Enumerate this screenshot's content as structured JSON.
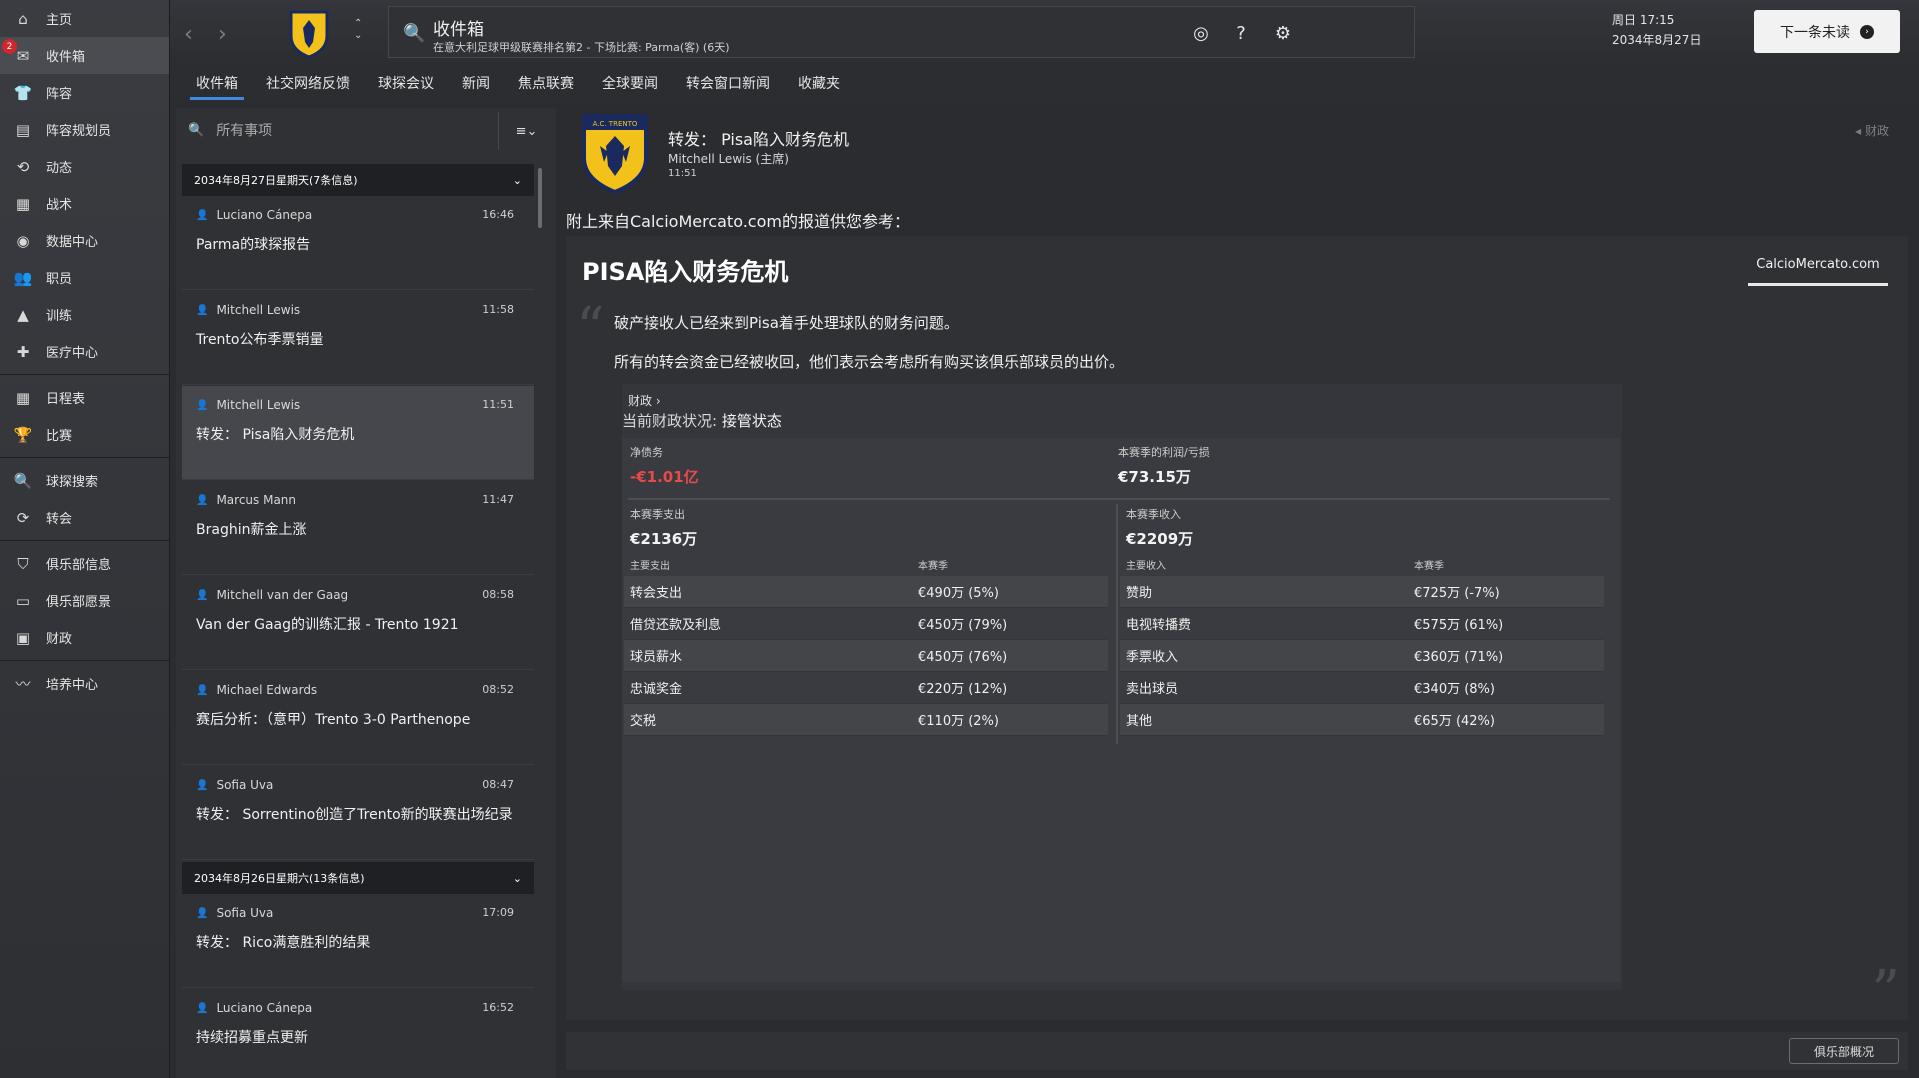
{
  "sidebar": {
    "items": [
      {
        "label": "主页",
        "icon": "home-icon"
      },
      {
        "label": "收件箱",
        "icon": "inbox-icon",
        "badge": "2"
      },
      {
        "label": "阵容",
        "icon": "shirt-icon"
      },
      {
        "label": "阵容规划员",
        "icon": "clipboard-icon"
      },
      {
        "label": "动态",
        "icon": "dynamics-icon"
      },
      {
        "label": "战术",
        "icon": "tactics-icon"
      },
      {
        "label": "数据中心",
        "icon": "data-hub-icon"
      },
      {
        "label": "职员",
        "icon": "staff-icon"
      },
      {
        "label": "训练",
        "icon": "training-icon"
      },
      {
        "label": "医疗中心",
        "icon": "medical-icon"
      },
      {
        "label": "日程表",
        "icon": "calendar-icon"
      },
      {
        "label": "比赛",
        "icon": "trophy-icon"
      },
      {
        "label": "球探搜索",
        "icon": "search-icon"
      },
      {
        "label": "转会",
        "icon": "transfer-icon"
      },
      {
        "label": "俱乐部信息",
        "icon": "shield-icon"
      },
      {
        "label": "俱乐部愿景",
        "icon": "vision-icon"
      },
      {
        "label": "财政",
        "icon": "finance-icon"
      },
      {
        "label": "培养中心",
        "icon": "development-icon"
      }
    ]
  },
  "topbar": {
    "search_title": "收件箱",
    "search_sub": "在意大利足球甲级联赛排名第2 - 下场比赛: Parma(客) (6天)",
    "day_time": "周日 17:15",
    "date": "2034年8月27日",
    "next_button": "下一条未读"
  },
  "tabs": [
    "收件箱",
    "社交网络反馈",
    "球探会议",
    "新闻",
    "焦点联赛",
    "全球要闻",
    "转会窗口新闻",
    "收藏夹"
  ],
  "list": {
    "search_placeholder": "所有事项",
    "group1": "2034年8月27日星期天(7条信息)",
    "group2": "2034年8月26日星期六(13条信息)",
    "messages": [
      {
        "from": "Luciano Cánepa",
        "time": "16:46",
        "subject": "Parma的球探报告"
      },
      {
        "from": "Mitchell Lewis",
        "time": "11:58",
        "subject": "Trento公布季票销量"
      },
      {
        "from": "Mitchell Lewis",
        "time": "11:51",
        "subject": "转发：  Pisa陷入财务危机"
      },
      {
        "from": "Marcus Mann",
        "time": "11:47",
        "subject": "Braghin薪金上涨"
      },
      {
        "from": "Mitchell van der Gaag",
        "time": "08:58",
        "subject": "Van der Gaag的训练汇报 - Trento 1921"
      },
      {
        "from": "Michael Edwards",
        "time": "08:52",
        "subject": "赛后分析：（意甲）Trento 3-0 Parthenope"
      },
      {
        "from": "Sofia Uva",
        "time": "08:47",
        "subject": "转发：  Sorrentino创造了Trento新的联赛出场纪录"
      },
      {
        "from": "Sofia Uva",
        "time": "17:09",
        "subject": "转发：  Rico满意胜利的结果"
      },
      {
        "from": "Luciano Cánepa",
        "time": "16:52",
        "subject": "持续招募重点更新"
      }
    ]
  },
  "article": {
    "crest_text": "A.C. TRENTO",
    "title": "转发：  Pisa陷入财务危机",
    "author": "Mitchell Lewis (主席)",
    "time": "11:51",
    "tag": "财政",
    "intro": "附上来自CalcioMercato.com的报道供您参考：",
    "headline": "PISA陷入财务危机",
    "source": "CalcioMercato.com",
    "para1": "破产接收人已经来到Pisa着手处理球队的财务问题。",
    "para2": "所有的转会资金已经被收回，他们表示会考虑所有购买该俱乐部球员的出价。",
    "finance": {
      "link": "财政",
      "status_label": "当前财政状况: ",
      "status_value": "接管状态",
      "net_debt_label": "净债务",
      "net_debt": "-€1.01亿",
      "profit_label": "本赛季的利润/亏损",
      "profit": "€73.15万",
      "expense_label": "本赛季支出",
      "expense": "€2136万",
      "income_label": "本赛季收入",
      "income": "€2209万",
      "expense_head": [
        "主要支出",
        "本赛季"
      ],
      "income_head": [
        "主要收入",
        "本赛季"
      ],
      "expense_rows": [
        [
          "转会支出",
          "€490万 (5%)"
        ],
        [
          "借贷还款及利息",
          "€450万 (79%)"
        ],
        [
          "球员薪水",
          "€450万 (76%)"
        ],
        [
          "忠诚奖金",
          "€220万 (12%)"
        ],
        [
          "交税",
          "€110万 (2%)"
        ]
      ],
      "income_rows": [
        [
          "赞助",
          "€725万 (-7%)"
        ],
        [
          "电视转播费",
          "€575万 (61%)"
        ],
        [
          "季票收入",
          "€360万 (71%)"
        ],
        [
          "卖出球员",
          "€340万 (8%)"
        ],
        [
          "其他",
          "€65万 (42%)"
        ]
      ]
    }
  },
  "watermark": "俱乐部概况"
}
